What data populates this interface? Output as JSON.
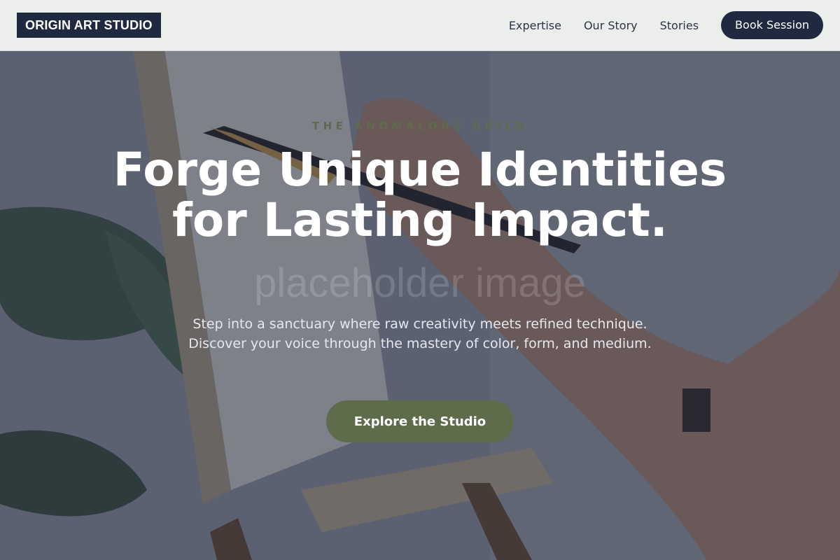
{
  "brand": {
    "name": "ORIGIN ART STUDIO"
  },
  "nav": {
    "links": [
      "Expertise",
      "Our Story",
      "Stories"
    ],
    "cta": "Book Session"
  },
  "hero": {
    "eyebrow": "THE ANOMALOUS GUILD",
    "title": "Forge Unique Identities for Lasting Impact.",
    "watermark": "placeholder image",
    "subtitle": "Step into a sanctuary where raw creativity meets refined technique. Discover your voice through the mastery of color, form, and medium.",
    "cta": "Explore the Studio"
  },
  "colors": {
    "navy": "#1f2940",
    "olive": "#5f6c4c",
    "header_bg": "#eceeec"
  }
}
